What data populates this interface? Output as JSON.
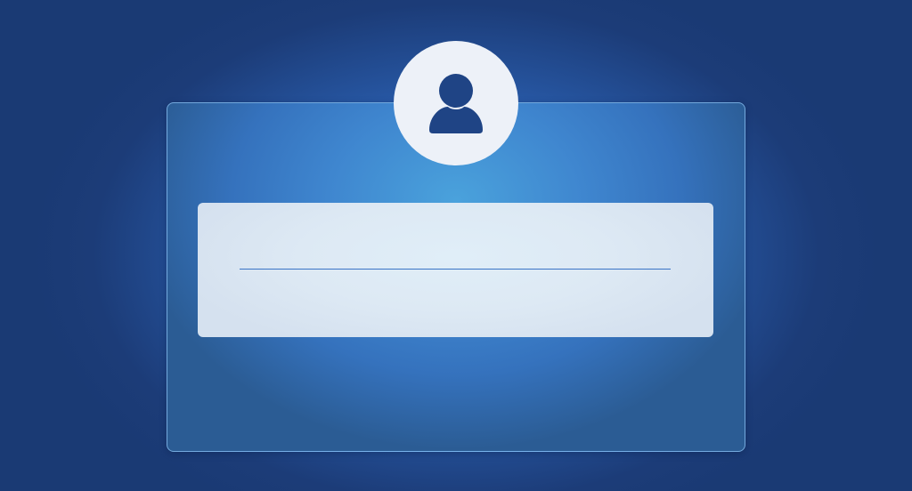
{
  "login": {
    "avatar_icon": "user-icon",
    "field": {
      "value": "",
      "placeholder": ""
    }
  },
  "colors": {
    "background": "#1a3a74",
    "card": "#3f86cf",
    "panel": "#dde9f4",
    "avatar_bg": "#edf1f8",
    "icon": "#1f4485",
    "underline": "#3a74c6"
  }
}
